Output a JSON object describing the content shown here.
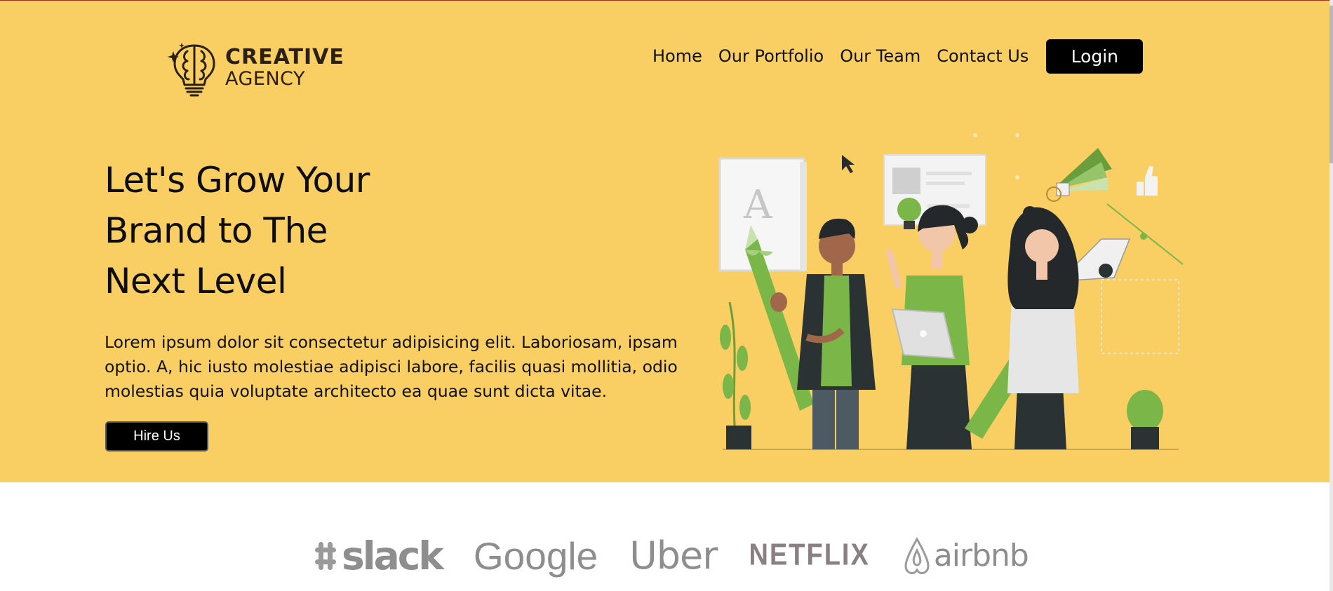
{
  "brand": {
    "name_line1": "CREATIVE",
    "name_line2": "AGENCY"
  },
  "nav": {
    "items": [
      {
        "label": "Home"
      },
      {
        "label": "Our Portfolio"
      },
      {
        "label": "Our Team"
      },
      {
        "label": "Contact Us"
      }
    ],
    "login_label": "Login"
  },
  "hero": {
    "headline_lines": [
      "Let's Grow Your",
      "Brand to The",
      "Next Level"
    ],
    "description": "Lorem ipsum dolor sit consectetur adipisicing elit. Laboriosam, ipsam optio. A, hic iusto molestiae adipisci labore, facilis quasi mollitia, odio molestias quia voluptate architecto ea quae sunt dicta vitae.",
    "cta_label": "Hire Us",
    "illustration_letter": "A"
  },
  "partners": [
    {
      "name": "slack",
      "icon": "slack-icon"
    },
    {
      "name": "Google"
    },
    {
      "name": "Uber"
    },
    {
      "name": "NETFLIX"
    },
    {
      "name": "airbnb",
      "icon": "airbnb-icon"
    }
  ],
  "colors": {
    "hero_bg": "#F9CE63",
    "accent_green": "#7AB648",
    "dark": "#000000",
    "logo_gray": "#8e8e8e"
  }
}
